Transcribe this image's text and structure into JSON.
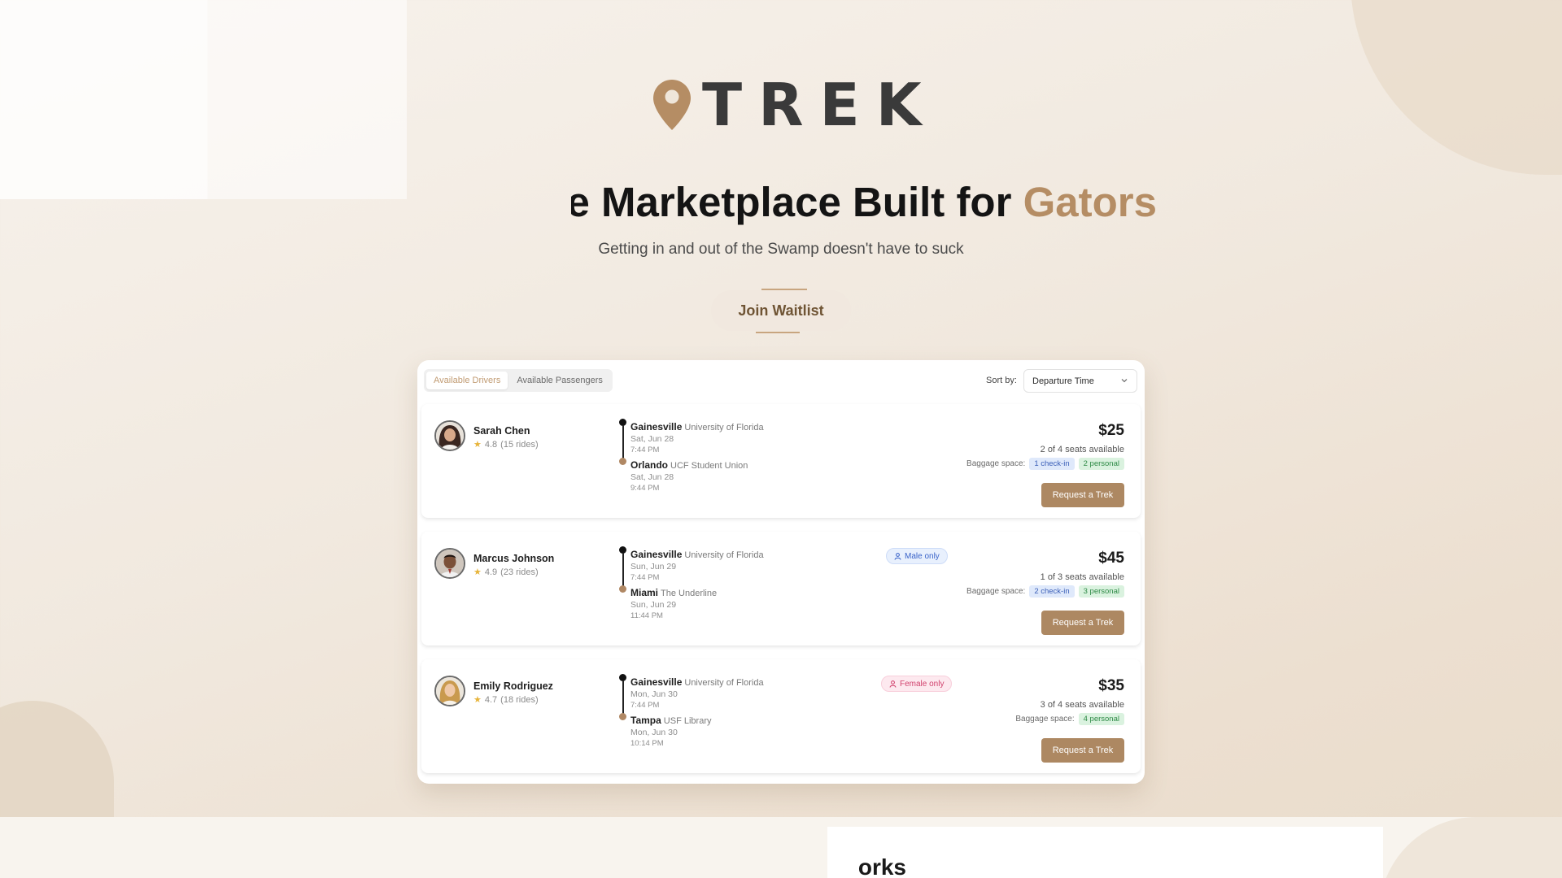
{
  "brand": {
    "name": "TREK",
    "accent_color": "#b58d64",
    "pin_icon": "map-pin-icon"
  },
  "hero": {
    "headline_visible": "re Marketplace Built for",
    "headline_accent": "Gators",
    "subtitle": "Getting in and out of the Swamp doesn't have to suck",
    "cta_label": "Join Waitlist"
  },
  "board": {
    "tabs": [
      {
        "label": "Available Drivers",
        "active": true
      },
      {
        "label": "Available Passengers",
        "active": false
      }
    ],
    "sort_label": "Sort by:",
    "sort_value": "Departure Time",
    "baggage_label": "Baggage space:",
    "request_label": "Request a Trek",
    "rides": [
      {
        "driver": "Sarah Chen",
        "rating": "4.8",
        "rides": "(15 rides)",
        "from_city": "Gainesville",
        "from_place": "University of Florida",
        "from_date": "Sat, Jun 28",
        "from_time": "7:44 PM",
        "to_city": "Orlando",
        "to_place": "UCF Student Union",
        "to_date": "Sat, Jun 28",
        "to_time": "9:44 PM",
        "gender": "",
        "price": "$25",
        "seats": "2 of 4 seats available",
        "checkin": "1 check-in",
        "personal": "2 personal"
      },
      {
        "driver": "Marcus Johnson",
        "rating": "4.9",
        "rides": "(23 rides)",
        "from_city": "Gainesville",
        "from_place": "University of Florida",
        "from_date": "Sun, Jun 29",
        "from_time": "7:44 PM",
        "to_city": "Miami",
        "to_place": "The Underline",
        "to_date": "Sun, Jun 29",
        "to_time": "11:44 PM",
        "gender": "Male only",
        "price": "$45",
        "seats": "1 of 3 seats available",
        "checkin": "2 check-in",
        "personal": "3 personal"
      },
      {
        "driver": "Emily Rodriguez",
        "rating": "4.7",
        "rides": "(18 rides)",
        "from_city": "Gainesville",
        "from_place": "University of Florida",
        "from_date": "Mon, Jun 30",
        "from_time": "7:44 PM",
        "to_city": "Tampa",
        "to_place": "USF Library",
        "to_date": "Mon, Jun 30",
        "to_time": "10:14 PM",
        "gender": "Female only",
        "price": "$35",
        "seats": "3 of 4 seats available",
        "checkin": "",
        "personal": "4 personal"
      }
    ]
  },
  "next_section": {
    "heading_visible": "orks"
  }
}
